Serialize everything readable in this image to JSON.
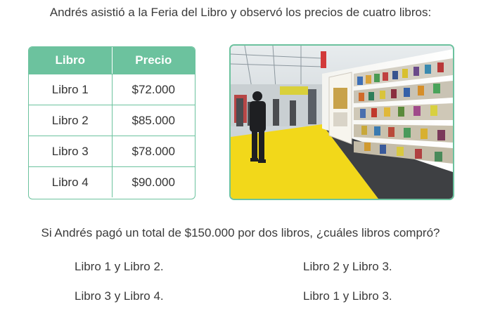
{
  "intro": "Andrés asistió a la Feria del Libro y observó los precios de cuatro libros:",
  "table": {
    "headers": [
      "Libro",
      "Precio"
    ],
    "rows": [
      [
        "Libro 1",
        "$72.000"
      ],
      [
        "Libro 2",
        "$85.000"
      ],
      [
        "Libro 3",
        "$78.000"
      ],
      [
        "Libro 4",
        "$90.000"
      ]
    ]
  },
  "colors": {
    "accent": "#6cc29e",
    "floor": "#f2d81a"
  },
  "question": "Si Andrés pagó un total de $150.000 por dos libros, ¿cuáles libros compró?",
  "options": [
    "Libro 1 y Libro 2.",
    "Libro 2 y Libro 3.",
    "Libro 3 y Libro 4.",
    "Libro 1 y Libro 3."
  ]
}
